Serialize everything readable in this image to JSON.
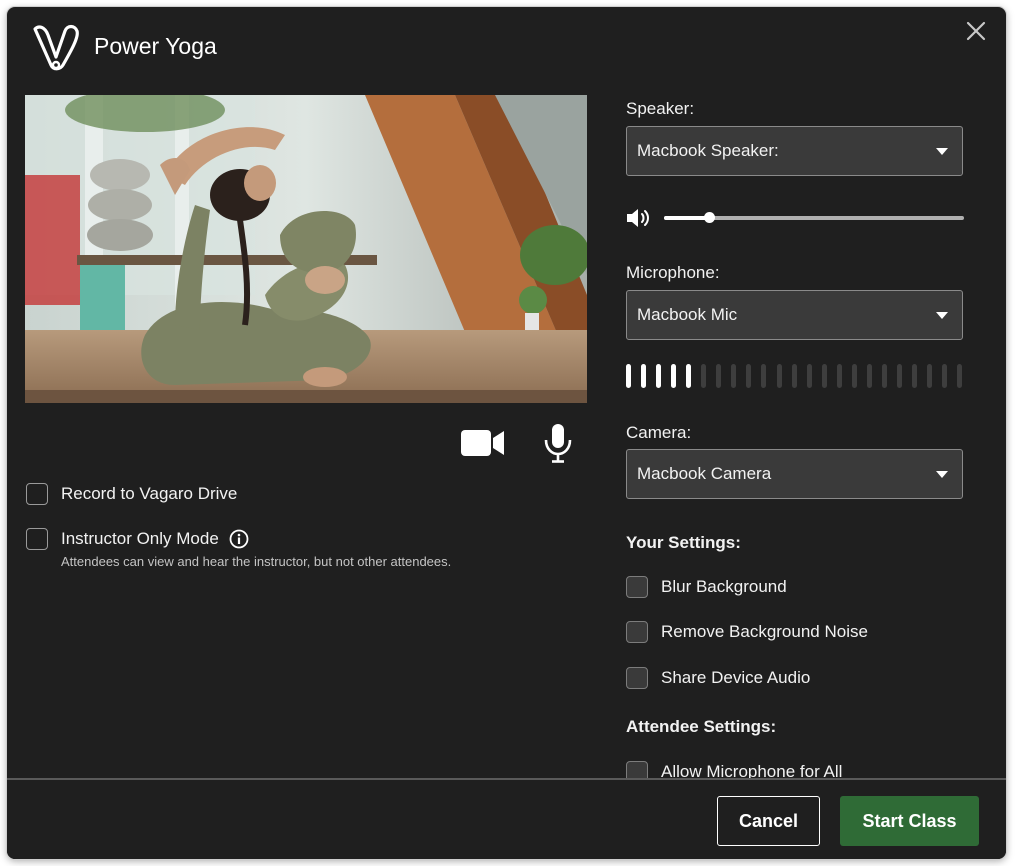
{
  "dialog": {
    "title": "Power Yoga",
    "logo_icon": "vagaro-v-logo",
    "close_icon": "close-icon"
  },
  "preview": {
    "description_icon": "camera-preview-image",
    "camera_icon": "video-camera-icon",
    "mic_icon": "microphone-icon"
  },
  "left_options": {
    "record": {
      "label": "Record to Vagaro Drive",
      "checked": false
    },
    "instructor_only": {
      "label": "Instructor Only Mode",
      "checked": false,
      "helper": "Attendees can view and hear the instructor, but not other attendees."
    }
  },
  "devices": {
    "speaker": {
      "label": "Speaker:",
      "value": "Macbook Speaker:"
    },
    "volume": {
      "level_fraction": 0.15
    },
    "microphone": {
      "label": "Microphone:",
      "value": "Macbook Mic"
    },
    "mic_level": {
      "bars_total": 23,
      "bars_active": 5
    },
    "camera": {
      "label": "Camera:",
      "value": "Macbook Camera"
    }
  },
  "your_settings": {
    "heading": "Your Settings:",
    "items": [
      {
        "label": "Blur Background",
        "checked": false
      },
      {
        "label": "Remove Background Noise",
        "checked": false
      },
      {
        "label": "Share Device Audio",
        "checked": false
      }
    ]
  },
  "attendee_settings": {
    "heading": "Attendee Settings:",
    "items": [
      {
        "label": "Allow Microphone for All",
        "checked": false
      }
    ]
  },
  "footer": {
    "cancel_label": "Cancel",
    "start_label": "Start Class"
  },
  "colors": {
    "dialog_bg": "#1f1f1f",
    "select_bg": "#3a3a3a",
    "primary_button": "#2f6b36",
    "text": "#f2f2f2"
  }
}
